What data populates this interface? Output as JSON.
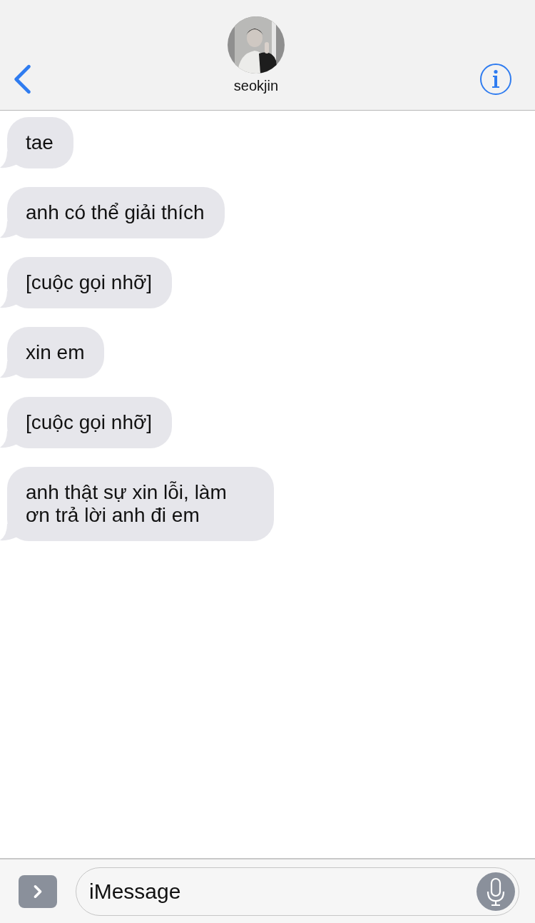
{
  "header": {
    "contact_name": "seokjin"
  },
  "messages": [
    {
      "text": "tae"
    },
    {
      "text": "anh có thể giải thích"
    },
    {
      "text": "[cuộc gọi nhỡ]"
    },
    {
      "text": "xin em"
    },
    {
      "text": "[cuộc gọi nhỡ]"
    },
    {
      "text": "anh thật sự xin lỗi, làm ơn trả lời anh đi em"
    }
  ],
  "compose": {
    "placeholder": "iMessage"
  }
}
